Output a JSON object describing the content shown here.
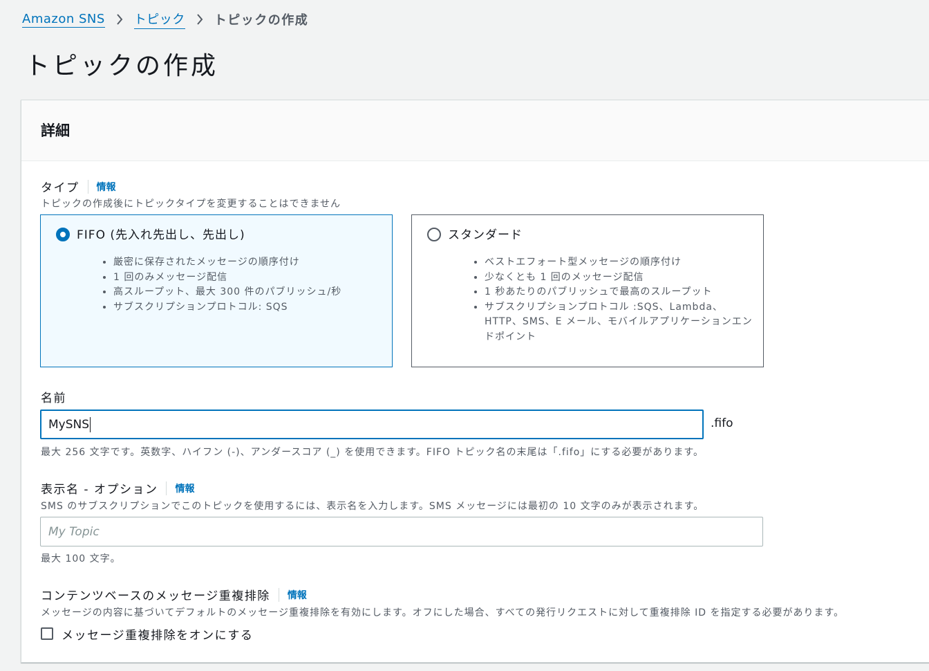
{
  "breadcrumb": {
    "items": [
      "Amazon SNS",
      "トピック"
    ],
    "current": "トピックの作成"
  },
  "page_title": "トピックの作成",
  "panel": {
    "title": "詳細",
    "type": {
      "label": "タイプ",
      "info": "情報",
      "description": "トピックの作成後にトピックタイプを変更することはできません",
      "options": [
        {
          "title": "FIFO (先入れ先出し、先出し)",
          "selected": true,
          "bullets": [
            "厳密に保存されたメッセージの順序付け",
            "1 回のみメッセージ配信",
            "高スループット、最大 300 件のパブリッシュ/秒",
            "サブスクリプションプロトコル: SQS"
          ]
        },
        {
          "title": "スタンダード",
          "selected": false,
          "bullets": [
            "ベストエフォート型メッセージの順序付け",
            "少なくとも 1 回のメッセージ配信",
            "1 秒あたりのパブリッシュで最高のスループット",
            "サブスクリプションプロトコル :SQS、Lambda、HTTP、SMS、E メール、モバイルアプリケーションエンドポイント"
          ]
        }
      ]
    },
    "name": {
      "label": "名前",
      "value": "MySNS",
      "suffix": ".fifo",
      "hint": "最大 256 文字です。英数字、ハイフン (-)、アンダースコア (_) を使用できます。FIFO トピック名の末尾は「.fifo」にする必要があります。"
    },
    "display_name": {
      "label": "表示名 - オプション",
      "info": "情報",
      "description": "SMS のサブスクリプションでこのトピックを使用するには、表示名を入力します。SMS メッセージには最初の 10 文字のみが表示されます。",
      "placeholder": "My Topic",
      "hint": "最大 100 文字。"
    },
    "dedup": {
      "label": "コンテンツベースのメッセージ重複排除",
      "info": "情報",
      "description": "メッセージの内容に基づいてデフォルトのメッセージ重複排除を有効にします。オフにした場合、すべての発行リクエストに対して重複排除 ID を指定する必要があります。",
      "checkbox_label": "メッセージ重複排除をオンにする",
      "checked": false
    }
  },
  "colors": {
    "link": "#0073bb",
    "selected_bg": "#f1faff",
    "background": "#f2f3f3"
  }
}
